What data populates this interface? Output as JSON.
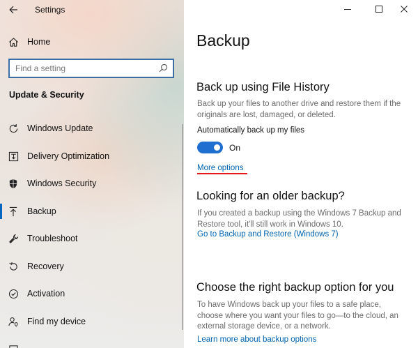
{
  "app": {
    "title": "Settings"
  },
  "nav": {
    "home_label": "Home",
    "search_placeholder": "Find a setting",
    "section_heading": "Update & Security",
    "items": [
      {
        "label": "Windows Update",
        "icon": "refresh-icon"
      },
      {
        "label": "Delivery Optimization",
        "icon": "delivery-optimization-icon"
      },
      {
        "label": "Windows Security",
        "icon": "shield-icon"
      },
      {
        "label": "Backup",
        "icon": "backup-upload-icon",
        "selected": true
      },
      {
        "label": "Troubleshoot",
        "icon": "wrench-icon"
      },
      {
        "label": "Recovery",
        "icon": "recovery-icon"
      },
      {
        "label": "Activation",
        "icon": "activation-check-icon"
      },
      {
        "label": "Find my device",
        "icon": "person-location-icon"
      }
    ]
  },
  "page": {
    "title": "Backup",
    "file_history": {
      "heading": "Back up using File History",
      "description": "Back up your files to another drive and restore them if the originals are lost, damaged, or deleted.",
      "toggle_label": "Automatically back up my files",
      "toggle_state": "On",
      "more_options": "More options"
    },
    "older_backup": {
      "heading": "Looking for an older backup?",
      "description": "If you created a backup using the Windows 7 Backup and Restore tool, it'll still work in Windows 10.",
      "link": "Go to Backup and Restore (Windows 7)"
    },
    "right_option": {
      "heading": "Choose the right backup option for you",
      "description": "To have Windows back up your files to a safe place, choose where you want your files to go—to the cloud, an external storage device, or a network.",
      "link": "Learn more about backup options"
    }
  },
  "colors": {
    "accent": "#0067c0",
    "toggle_on": "#1f6fd1",
    "link": "#0063b1",
    "annotation_underline": "#e3171c",
    "search_border": "#3a6ea5"
  }
}
